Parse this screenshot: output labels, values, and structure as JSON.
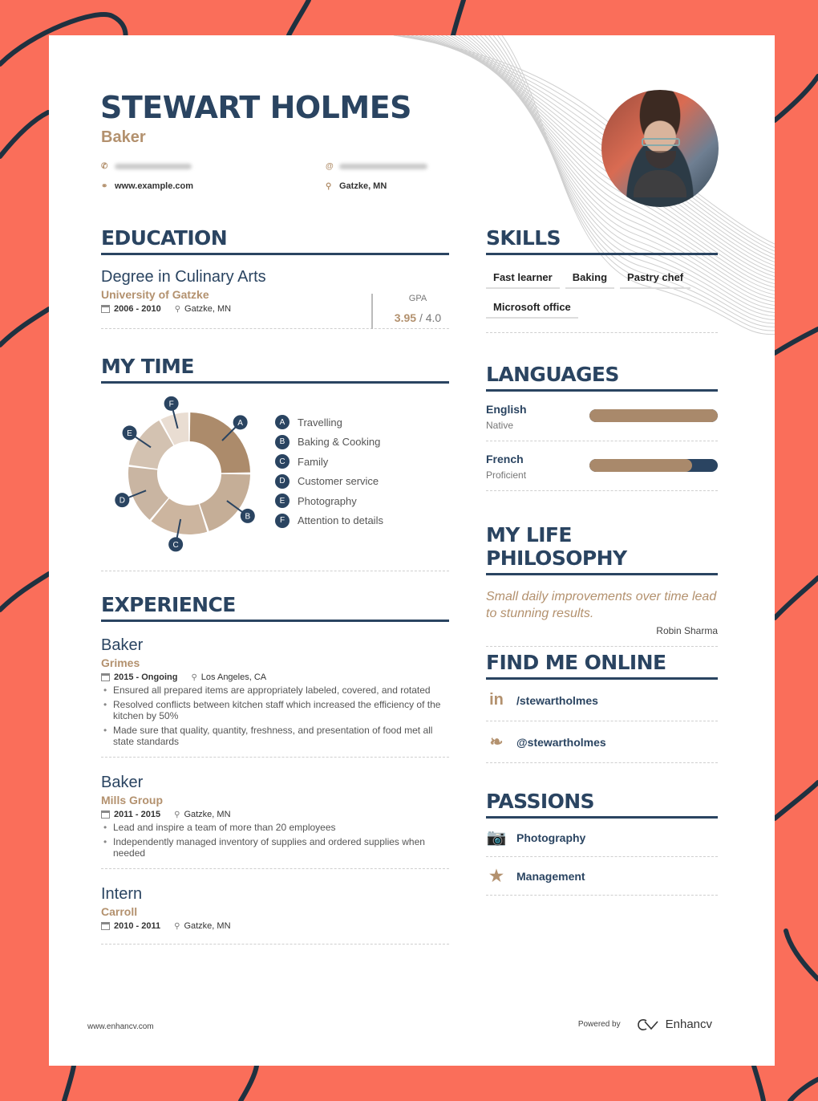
{
  "header": {
    "name": "STEWART HOLMES",
    "role": "Baker",
    "phone_icon": "phone-icon",
    "email_icon": "at-icon",
    "website_icon": "link-icon",
    "website": "www.example.com",
    "location_icon": "map-pin-icon",
    "location": "Gatzke, MN"
  },
  "education": {
    "title": "EDUCATION",
    "degree": "Degree in Culinary Arts",
    "school": "University of Gatzke",
    "dates": "2006 - 2010",
    "location": "Gatzke, MN",
    "gpa_label": "GPA",
    "gpa": "3.95",
    "gpa_sep": "/",
    "gpa_max": "4.0"
  },
  "my_time": {
    "title": "MY TIME"
  },
  "chart_data": {
    "type": "pie",
    "variant": "donut",
    "title": "MY TIME",
    "categories": [
      "Travelling",
      "Baking & Cooking",
      "Family",
      "Customer service",
      "Photography",
      "Attention to details"
    ],
    "markers": [
      "A",
      "B",
      "C",
      "D",
      "E",
      "F"
    ],
    "values": [
      25,
      20,
      16,
      16,
      15,
      8
    ],
    "colors": [
      "#ac8b6b",
      "#c5ae97",
      "#ccb59f",
      "#c9b5a2",
      "#d3c2b1",
      "#e9ddd2"
    ],
    "legend": "right"
  },
  "experience": {
    "title": "EXPERIENCE",
    "jobs": [
      {
        "title": "Baker",
        "company": "Grimes",
        "dates": "2015 - Ongoing",
        "location": "Los Angeles, CA",
        "bullets": [
          "Ensured all prepared items are appropriately labeled, covered, and rotated",
          "Resolved conflicts between kitchen staff which increased the efficiency of the kitchen by 50%",
          "Made sure that quality, quantity, freshness, and presentation of food met all state standards"
        ]
      },
      {
        "title": "Baker",
        "company": "Mills Group",
        "dates": "2011 - 2015",
        "location": "Gatzke, MN",
        "bullets": [
          "Lead and inspire a team of more than 20 employees",
          "Independently managed inventory of supplies and ordered supplies when needed"
        ]
      },
      {
        "title": "Intern",
        "company": "Carroll",
        "dates": "2010 - 2011",
        "location": "Gatzke, MN",
        "bullets": []
      }
    ]
  },
  "skills": {
    "title": "SKILLS",
    "items": [
      "Fast learner",
      "Baking",
      "Pastry chef",
      "Microsoft office"
    ]
  },
  "languages": {
    "title": "LANGUAGES",
    "items": [
      {
        "name": "English",
        "level": "Native",
        "proficiency": 1.0
      },
      {
        "name": "French",
        "level": "Proficient",
        "proficiency": 0.8
      }
    ]
  },
  "philosophy": {
    "title": "MY LIFE PHILOSOPHY",
    "quote": "Small daily improvements over time lead to stunning results.",
    "author": "Robin Sharma"
  },
  "online": {
    "title": "FIND ME ONLINE",
    "items": [
      {
        "icon": "linkedin-icon",
        "label": "/stewartholmes"
      },
      {
        "icon": "twitter-icon",
        "label": "@stewartholmes"
      }
    ]
  },
  "passions": {
    "title": "PASSIONS",
    "items": [
      {
        "icon": "camera-icon",
        "label": "Photography"
      },
      {
        "icon": "star-icon",
        "label": "Management"
      }
    ]
  },
  "footer": {
    "site": "www.enhancv.com",
    "powered_by": "Powered by",
    "brand": "Enhancv"
  },
  "colors": {
    "background": "#fa6e5a",
    "navy": "#2a4461",
    "accent": "#b3916e"
  }
}
